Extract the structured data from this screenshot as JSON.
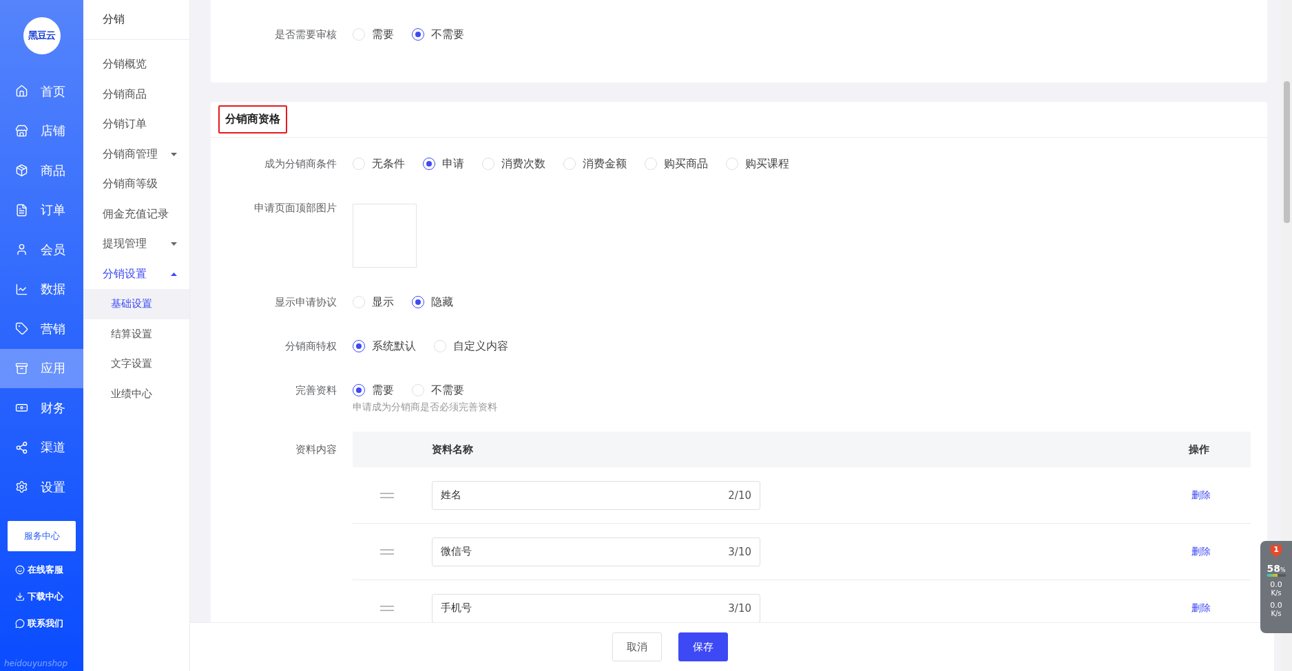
{
  "logo": {
    "text": "黑豆云"
  },
  "nav": [
    {
      "label": "首页",
      "selected": false
    },
    {
      "label": "店铺",
      "selected": false
    },
    {
      "label": "商品",
      "selected": false
    },
    {
      "label": "订单",
      "selected": false
    },
    {
      "label": "会员",
      "selected": false
    },
    {
      "label": "数据",
      "selected": false
    },
    {
      "label": "营销",
      "selected": false
    },
    {
      "label": "应用",
      "selected": true
    },
    {
      "label": "财务",
      "selected": false
    },
    {
      "label": "渠道",
      "selected": false
    },
    {
      "label": "设置",
      "selected": false
    }
  ],
  "service_button": "服务中心",
  "help_links": [
    {
      "label": "在线客服"
    },
    {
      "label": "下载中心"
    },
    {
      "label": "联系我们"
    }
  ],
  "brand_text": "heidouyunshop",
  "submenu": {
    "title": "分销",
    "items": [
      {
        "label": "分销概览",
        "selected": false
      },
      {
        "label": "分销商品",
        "selected": false
      },
      {
        "label": "分销订单",
        "selected": false
      },
      {
        "label": "分销商管理",
        "selected": false,
        "expanded": false
      },
      {
        "label": "分销商等级",
        "selected": false
      },
      {
        "label": "佣金充值记录",
        "selected": false
      },
      {
        "label": "提现管理",
        "selected": false,
        "expanded": false
      },
      {
        "label": "分销设置",
        "selected": true,
        "expanded": true,
        "children": [
          {
            "label": "基础设置",
            "selected": true
          },
          {
            "label": "结算设置",
            "selected": false
          },
          {
            "label": "文字设置",
            "selected": false
          },
          {
            "label": "业绩中心",
            "selected": false
          }
        ]
      }
    ]
  },
  "cards": [
    {
      "rows": [
        {
          "kind": "radio",
          "label": "是否需要审核",
          "options": [
            {
              "label": "需要",
              "selected": false
            },
            {
              "label": "不需要",
              "selected": true
            }
          ]
        }
      ]
    },
    {
      "title": "分销商资格",
      "title_highlighted": true,
      "rows": [
        {
          "kind": "radio",
          "label": "成为分销商条件",
          "options": [
            {
              "label": "无条件",
              "selected": false
            },
            {
              "label": "申请",
              "selected": true
            },
            {
              "label": "消费次数",
              "selected": false
            },
            {
              "label": "消费金额",
              "selected": false
            },
            {
              "label": "购买商品",
              "selected": false
            },
            {
              "label": "购买课程",
              "selected": false
            }
          ]
        },
        {
          "kind": "image",
          "label": "申请页面顶部图片"
        },
        {
          "kind": "radio",
          "label": "显示申请协议",
          "options": [
            {
              "label": "显示",
              "selected": false
            },
            {
              "label": "隐藏",
              "selected": true
            }
          ]
        },
        {
          "kind": "radio",
          "label": "分销商特权",
          "options": [
            {
              "label": "系统默认",
              "selected": true
            },
            {
              "label": "自定义内容",
              "selected": false
            }
          ]
        },
        {
          "kind": "radio",
          "label": "完善资料",
          "options": [
            {
              "label": "需要",
              "selected": true
            },
            {
              "label": "不需要",
              "selected": false
            }
          ],
          "hint": "申请成为分销商是否必须完善资料"
        },
        {
          "kind": "table",
          "label": "资料内容",
          "columns": [
            "资料名称",
            "操作"
          ],
          "rows": [
            {
              "value": "姓名",
              "count": "2/10",
              "action": "删除"
            },
            {
              "value": "微信号",
              "count": "3/10",
              "action": "删除"
            },
            {
              "value": "手机号",
              "count": "3/10",
              "action": "删除"
            }
          ]
        }
      ]
    }
  ],
  "footer_buttons": [
    {
      "label": "取消",
      "kind": "default"
    },
    {
      "label": "保存",
      "kind": "primary"
    }
  ],
  "monitor": {
    "badge": "1",
    "percent": "58",
    "unit": "%",
    "level": 0.58,
    "upload": "0.0",
    "upload_unit": "K/s",
    "download": "0.0",
    "download_unit": "K/s"
  }
}
